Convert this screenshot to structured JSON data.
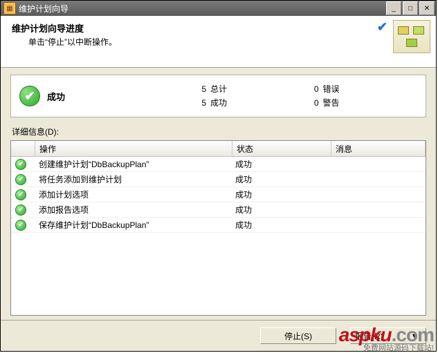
{
  "window": {
    "title": "维护计划向导"
  },
  "header": {
    "title": "维护计划向导进度",
    "subtitle": "单击“停止”以中断操作。"
  },
  "summary": {
    "status_label": "成功",
    "total_label": "总计",
    "total_value": "5",
    "success_label": "成功",
    "success_value": "5",
    "error_label": "错误",
    "error_value": "0",
    "warning_label": "警告",
    "warning_value": "0"
  },
  "details_label": "详细信息(D):",
  "columns": {
    "operation": "操作",
    "status": "状态",
    "message": "消息"
  },
  "rows": [
    {
      "op": "创建维护计划“DbBackupPlan”",
      "status": "成功",
      "msg": ""
    },
    {
      "op": "将任务添加到维护计划",
      "status": "成功",
      "msg": ""
    },
    {
      "op": "添加计划选项",
      "status": "成功",
      "msg": ""
    },
    {
      "op": "添加报告选项",
      "status": "成功",
      "msg": ""
    },
    {
      "op": "保存维护计划“DbBackupPlan”",
      "status": "成功",
      "msg": ""
    }
  ],
  "buttons": {
    "stop": "停止(S)",
    "report": "报告(R)"
  },
  "watermark": {
    "logo_main": "aspku",
    "logo_suffix": ".com",
    "tagline": "免费网站源码下载站!"
  }
}
